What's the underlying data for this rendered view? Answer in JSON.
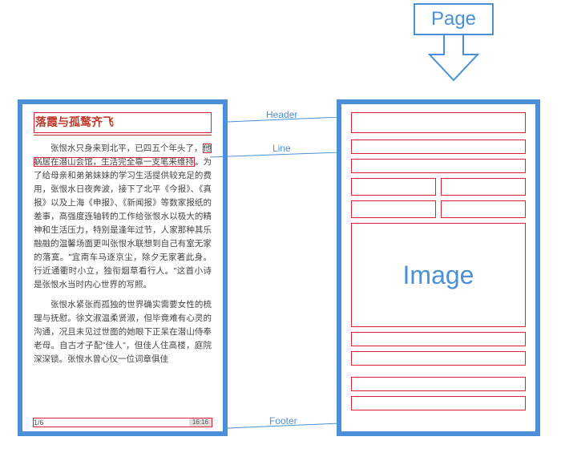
{
  "callout": {
    "label": "Page"
  },
  "annotations": {
    "header": "Header",
    "line": "Line",
    "footer": "Footer"
  },
  "left": {
    "title": "落霞与孤鹜齐飞",
    "paragraphs": [
      "张恨水只身来到北平，已四五个年头了，他蜗居在潜山会馆，生活完全靠一支笔来维持。为了给母亲和弟弟妹妹的学习生活提供较充足的费用，张恨水日夜奔波，接下了北平《今报》、《真报》以及上海《申报》、《新闻报》等数家报纸的差事，高强度连轴转的工作给张恨水以极大的精神和生活压力，特别是逢年过节，人家那种其乐融融的温馨场面更叫张恨水联想到自己有室无家的落寞。\"宜南车马逐京尘，除夕无家著此身。行近通衢时小立，独衔烟草看行人。\"这首小诗是张恨水当时内心世界的写照。",
      "张恨水紧张而孤独的世界确实需要女性的梳理与抚慰。徐文淑温柔贤淑，但毕竟难有心灵的沟通，况且未见过世面的她眼下正呆在潜山侍奉老母。自古才子配\"佳人\"，但佳人住高楼，庭院深深锁。张恨水曾心仪一位词章俱佳"
    ],
    "highlight_line": "他蜗居在潜山会馆，生活完全靠一支笔来维持",
    "footer": {
      "page_num": "1/6",
      "time": "16:16"
    }
  },
  "right": {
    "image_label": "Image"
  }
}
